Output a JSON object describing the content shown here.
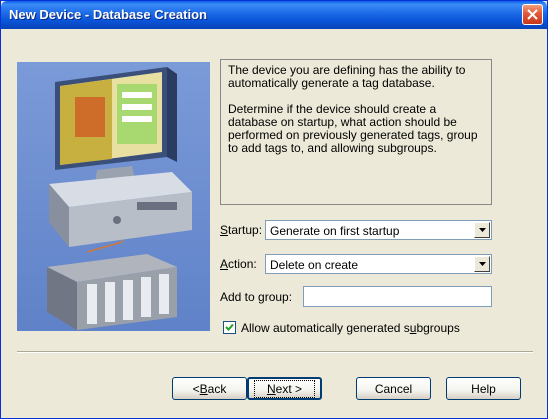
{
  "window": {
    "title": "New Device - Database Creation"
  },
  "description": {
    "paragraph1": "The device you are defining has the ability to automatically generate a tag database.",
    "paragraph2": "Determine if the device should create a database on startup, what action should be performed on previously generated tags, group to add tags to, and allowing subgroups."
  },
  "form": {
    "startup": {
      "label_hotkey": "S",
      "label_rest": "tartup:",
      "value": "Generate on first startup"
    },
    "action": {
      "label_hotkey": "A",
      "label_rest": "ction:",
      "value": "Delete on create"
    },
    "add_to_group": {
      "label": "Add to group:",
      "value": ""
    },
    "subgroups": {
      "label_before": "Allow automatically generated s",
      "label_hotkey": "u",
      "label_after": "bgroups",
      "checked": true
    }
  },
  "buttons": {
    "back_prefix": "< ",
    "back_hotkey": "B",
    "back_rest": "ack",
    "next_hotkey": "N",
    "next_rest": "ext >",
    "cancel": "Cancel",
    "help": "Help"
  },
  "icons": [
    "close-icon",
    "dropdown-arrow-icon",
    "checkmark-icon",
    "computer-plc-illustration"
  ]
}
